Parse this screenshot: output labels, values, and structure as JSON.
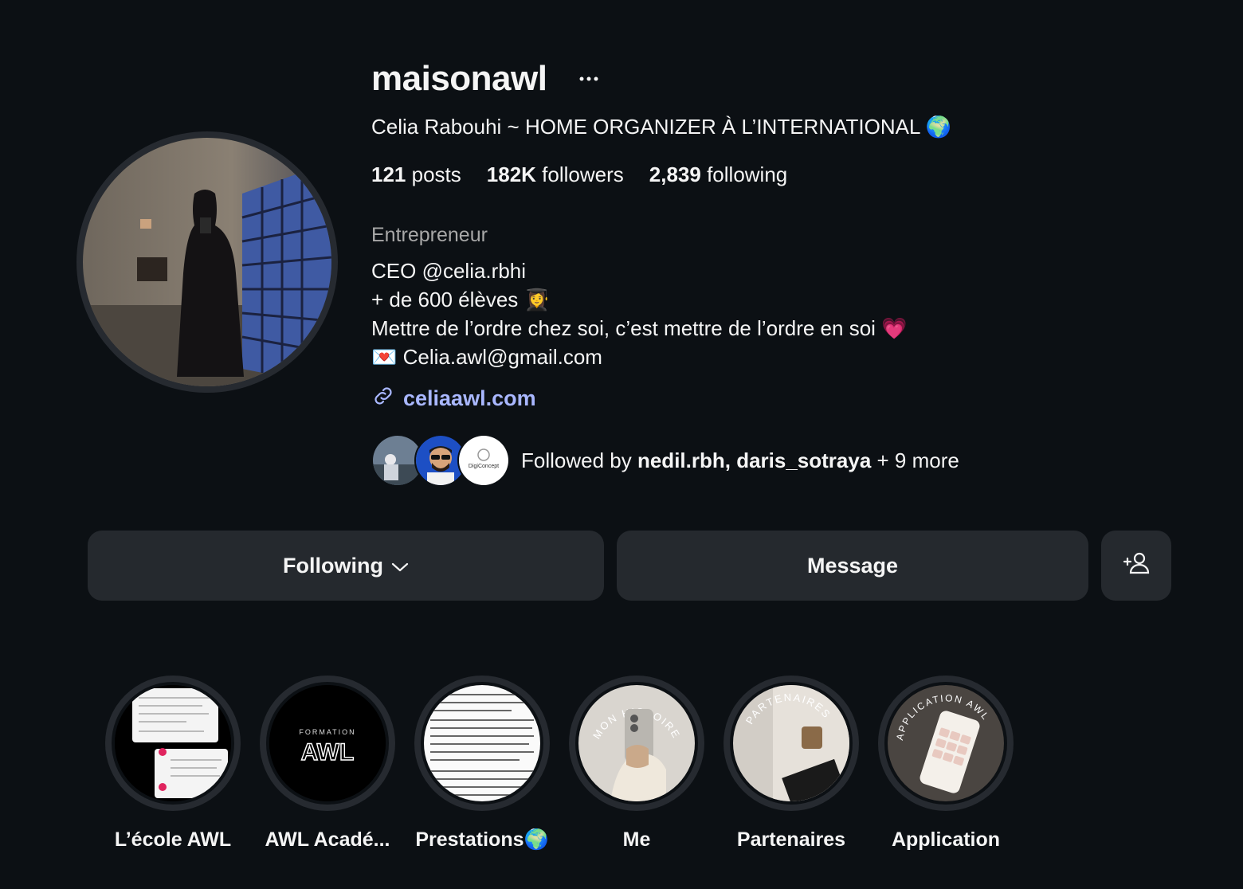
{
  "profile": {
    "username": "maisonawl",
    "more_icon": "ellipsis-icon",
    "full_name": "Celia Rabouhi ~ HOME ORGANIZER À L’INTERNATIONAL 🌍",
    "stats": {
      "posts_count": "121",
      "posts_label": "posts",
      "followers_count": "182K",
      "followers_label": "followers",
      "following_count": "2,839",
      "following_label": "following"
    },
    "category": "Entrepreneur",
    "bio_lines": [
      "CEO @celia.rbhi",
      "+ de 600 élèves 👩‍🎓",
      "Mettre de l’ordre chez soi, c’est mettre de l’ordre en soi 💗",
      "💌 Celia.awl@gmail.com"
    ],
    "link": {
      "icon": "link-icon",
      "text": "celiaawl.com"
    },
    "followed_by": {
      "prefix": "Followed by ",
      "names": "nedil.rbh, daris_sotraya",
      "suffix": " + 9 more",
      "mini_avatar_3_text": "DigiConcept"
    }
  },
  "actions": {
    "following_label": "Following",
    "message_label": "Message",
    "add_user_icon": "add-user-icon"
  },
  "highlights": [
    {
      "label": "L’école AWL"
    },
    {
      "label": "AWL Acadé...",
      "cover_text_top": "FORMATION",
      "cover_text_main": "AWL"
    },
    {
      "label": "Prestations🌍"
    },
    {
      "label": "Me",
      "cover_text": "MON HISTOIRE"
    },
    {
      "label": "Partenaires",
      "cover_text": "PARTENAIRES"
    },
    {
      "label": "Application",
      "cover_text": "APPLICATION AWL"
    }
  ],
  "colors": {
    "background": "#0c1014",
    "button": "#25292e",
    "link": "#a9b7ff",
    "secondary_text": "#a8a8a8"
  }
}
